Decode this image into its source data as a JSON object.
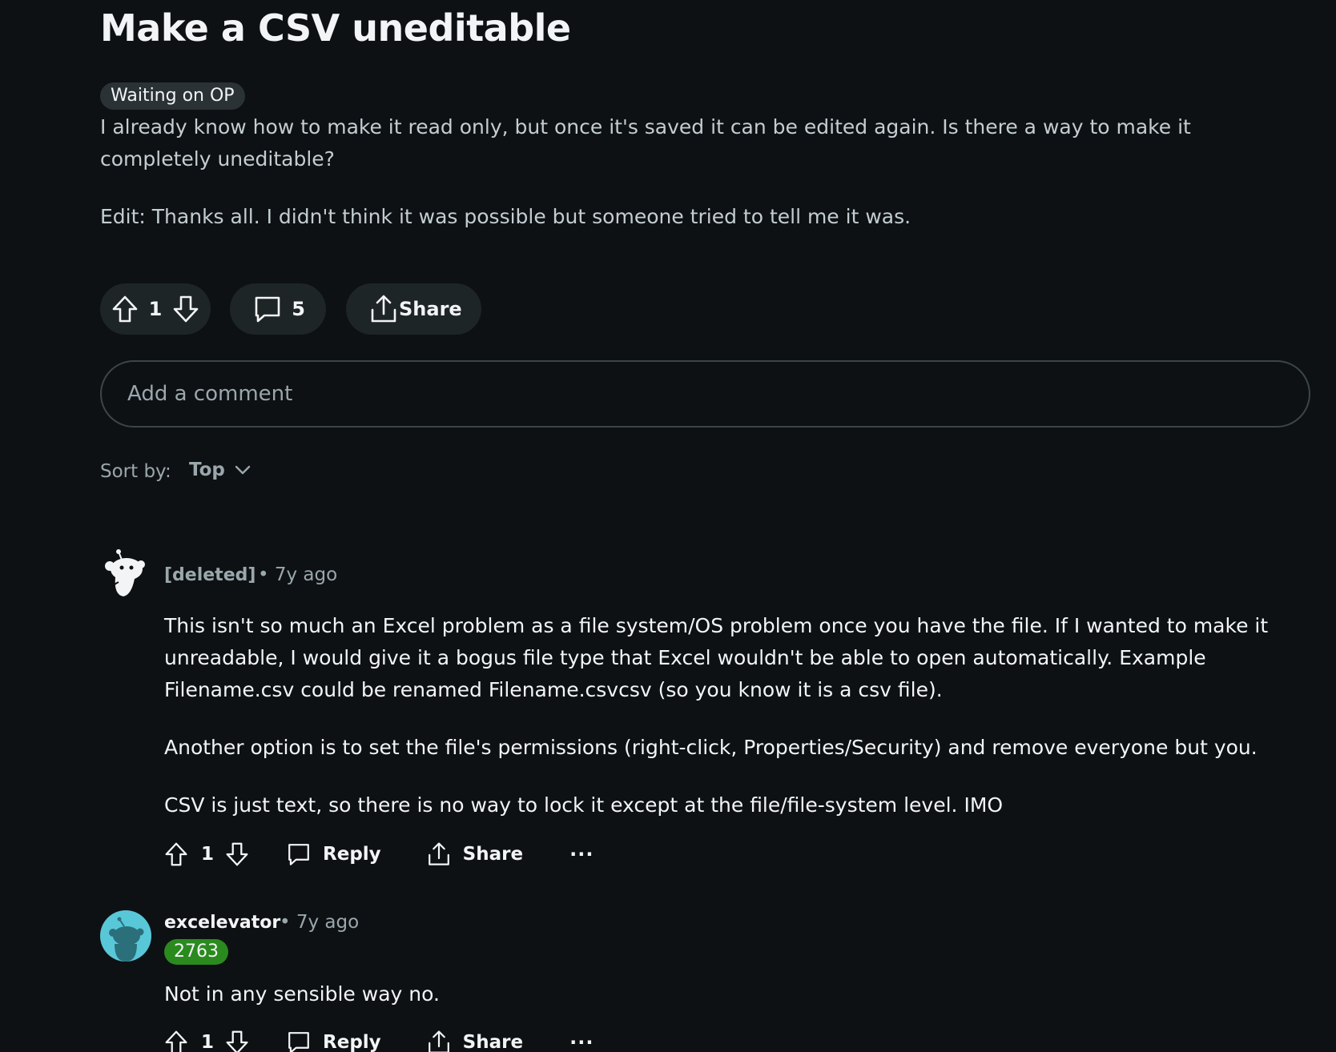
{
  "post": {
    "title": "Make a CSV uneditable",
    "flair": "Waiting on OP",
    "body_p1": "I already know how to make it read only, but once it's saved it can be edited again. Is there a way to make it completely uneditable?",
    "body_p2": "Edit: Thanks all. I didn't think it was possible but someone tried to tell me it was.",
    "score": "1",
    "comment_count": "5",
    "share_label": "Share"
  },
  "comment_input": {
    "placeholder": "Add a comment"
  },
  "sort": {
    "label": "Sort by:",
    "value": "Top"
  },
  "comments": [
    {
      "author": "[deleted]",
      "meta": "• 7y ago",
      "paragraphs": [
        "This isn't so much an Excel problem as a file system/OS problem once you have the file. If I wanted to make it unreadable, I would give it a bogus file type that Excel wouldn't be able to open automatically. Example Filename.csv could be renamed Filename.csvcsv (so you know it is a csv file).",
        "Another option is to set the file's permissions (right-click, Properties/Security) and remove everyone but you.",
        "CSV is just text, so there is no way to lock it except at the file/file-system level. IMO"
      ],
      "score": "1",
      "reply_label": "Reply",
      "share_label": "Share",
      "more_label": "···"
    },
    {
      "author": "excelevator",
      "meta": "• 7y ago",
      "flair": "2763",
      "paragraphs": [
        "Not in any sensible way no."
      ],
      "score": "1",
      "reply_label": "Reply",
      "share_label": "Share",
      "more_label": "···"
    }
  ],
  "colors": {
    "background": "#0e1113",
    "pill": "#1e2527",
    "muted": "#9aa7ad",
    "flair_green": "#2a8a1e",
    "avatar_teal": "#58c8d9"
  },
  "icons": [
    "upvote-icon",
    "downvote-icon",
    "comment-icon",
    "share-icon",
    "chevron-down-icon",
    "more-icon"
  ]
}
